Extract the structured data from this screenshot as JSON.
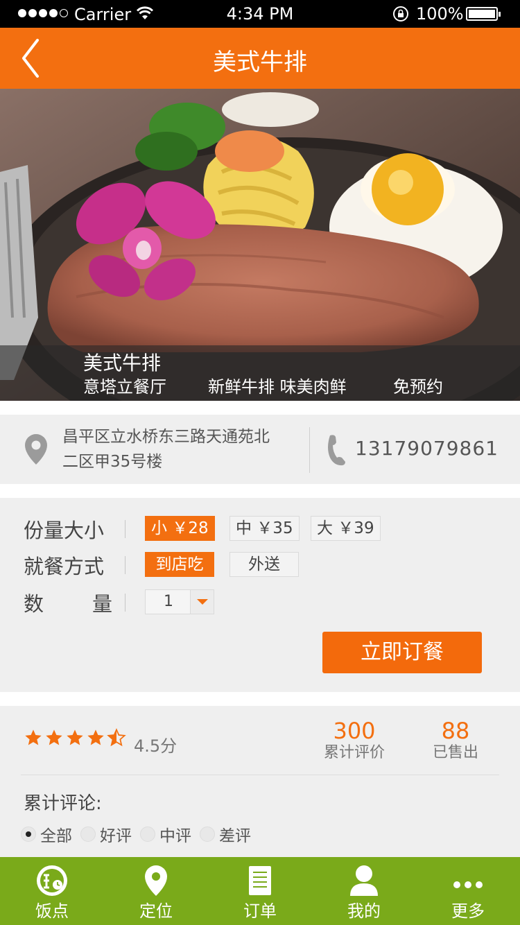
{
  "status_bar": {
    "carrier": "Carrier",
    "time": "4:34 PM",
    "battery": "100%"
  },
  "nav": {
    "title": "美式牛排"
  },
  "dish": {
    "name": "美式牛排",
    "restaurant": "意塔立餐厅",
    "tags": "新鲜牛排 味美肉鲜",
    "reservation": "免预约"
  },
  "location": {
    "address_line1": "昌平区立水桥东三路天通苑北",
    "address_line2": "二区甲35号楼",
    "phone": "13179079861"
  },
  "options": {
    "size_label": "份量大小",
    "sizes": [
      {
        "label": "小 ￥28",
        "active": true
      },
      {
        "label": "中 ￥35",
        "active": false
      },
      {
        "label": "大 ￥39",
        "active": false
      }
    ],
    "dining_label": "就餐方式",
    "dining": [
      {
        "label": "到店吃",
        "active": true
      },
      {
        "label": "外送",
        "active": false
      }
    ],
    "quantity_label_1": "数",
    "quantity_label_2": "量",
    "quantity_value": "1",
    "order_button": "立即订餐"
  },
  "reviews": {
    "rating": 4.5,
    "score_text": "4.5分",
    "total_reviews": "300",
    "total_reviews_label": "累计评价",
    "sold": "88",
    "sold_label": "已售出",
    "section_title": "累计评论:",
    "filters": [
      {
        "label": "全部",
        "selected": true
      },
      {
        "label": "好评",
        "selected": false
      },
      {
        "label": "中评",
        "selected": false
      },
      {
        "label": "差评",
        "selected": false
      }
    ]
  },
  "tabs": [
    {
      "label": "饭点",
      "icon": "rice-time-icon"
    },
    {
      "label": "定位",
      "icon": "location-pin-icon"
    },
    {
      "label": "订单",
      "icon": "order-document-icon"
    },
    {
      "label": "我的",
      "icon": "user-icon"
    },
    {
      "label": "更多",
      "icon": "more-dots-icon"
    }
  ],
  "colors": {
    "accent": "#f36f10",
    "tab_bar": "#7aaa1a",
    "card_bg": "#efefef"
  }
}
